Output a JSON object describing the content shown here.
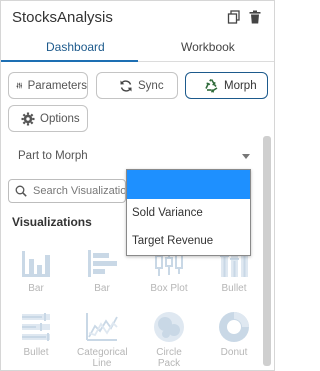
{
  "app": {
    "title": "StocksAnalysis"
  },
  "tabs": [
    {
      "label": "Dashboard",
      "active": true
    },
    {
      "label": "Workbook",
      "active": false
    }
  ],
  "buttons": {
    "parameters": "Parameters",
    "sync": "Sync",
    "morph": "Morph",
    "options": "Options"
  },
  "morph_select": {
    "label": "Part to Morph",
    "options": [
      "",
      "Sold Variance",
      "Target Revenue"
    ],
    "highlighted_index": 0
  },
  "search": {
    "placeholder": "Search Visualization"
  },
  "visualizations": {
    "heading": "Visualizations",
    "items": [
      {
        "label": "Bar",
        "icon": "bar-chart-vertical-icon"
      },
      {
        "label": "Bar",
        "icon": "bar-chart-horizontal-icon"
      },
      {
        "label": "Box Plot",
        "icon": "box-plot-icon"
      },
      {
        "label": "Bullet",
        "icon": "bullet-vertical-icon"
      },
      {
        "label": "Bullet",
        "icon": "bullet-horizontal-icon"
      },
      {
        "label": "Categorical Line",
        "icon": "categorical-line-icon"
      },
      {
        "label": "Circle Pack",
        "icon": "circle-pack-icon"
      },
      {
        "label": "Donut",
        "icon": "donut-icon"
      }
    ]
  },
  "colors": {
    "accent": "#1d5a8c",
    "tab_underline": "#1d6fb3",
    "dropdown_highlight": "#1e90ff",
    "icon_muted": "#c9d8e6",
    "label_muted": "#b6b6b6"
  }
}
